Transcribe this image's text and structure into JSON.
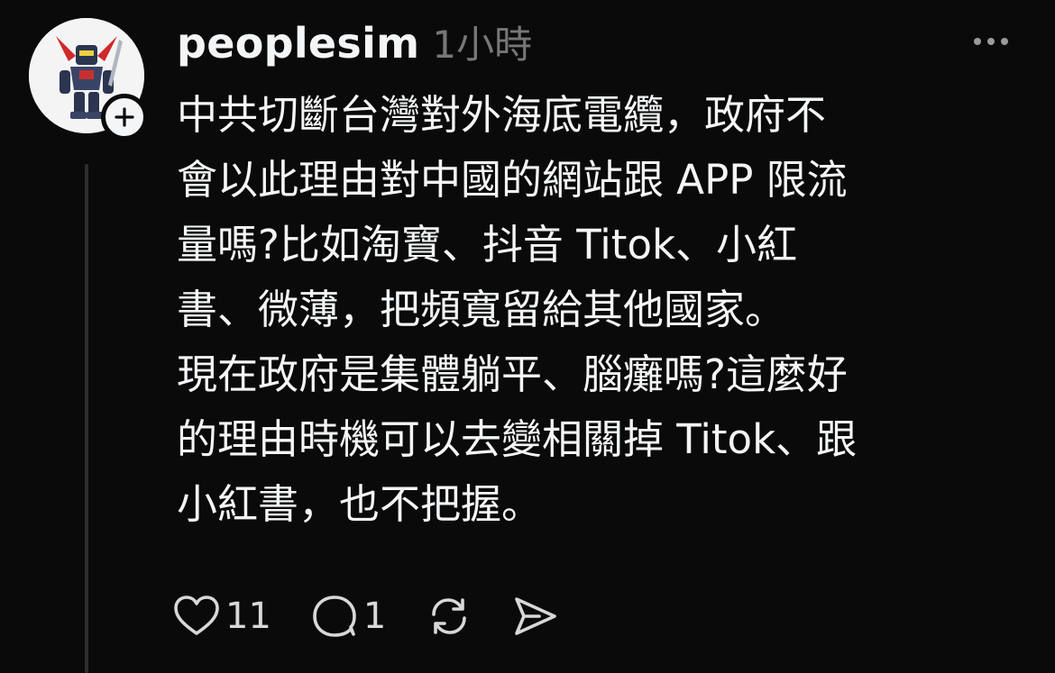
{
  "post": {
    "username": "peoplesim",
    "time": "1小時",
    "paragraphs": [
      "中共切斷台灣對外海底電纜，政府不\n會以此理由對中國的網站跟 APP 限流\n量嗎?比如淘寶、抖音 Titok、小紅\n書、微薄，把頻寬留給其他國家。",
      "現在政府是集體躺平、腦癱嗎?這麼好\n的理由時機可以去變相關掉 Titok、跟\n小紅書，也不把握。"
    ]
  },
  "actions": {
    "like_count": "11",
    "reply_count": "1"
  },
  "icons": {
    "more": "more-dots-icon",
    "follow": "plus-icon",
    "like": "heart-icon",
    "reply": "comment-icon",
    "repost": "repost-icon",
    "share": "send-icon"
  },
  "colors": {
    "background": "#0a0a0a",
    "text": "#f3f5f7",
    "muted": "#777777"
  }
}
